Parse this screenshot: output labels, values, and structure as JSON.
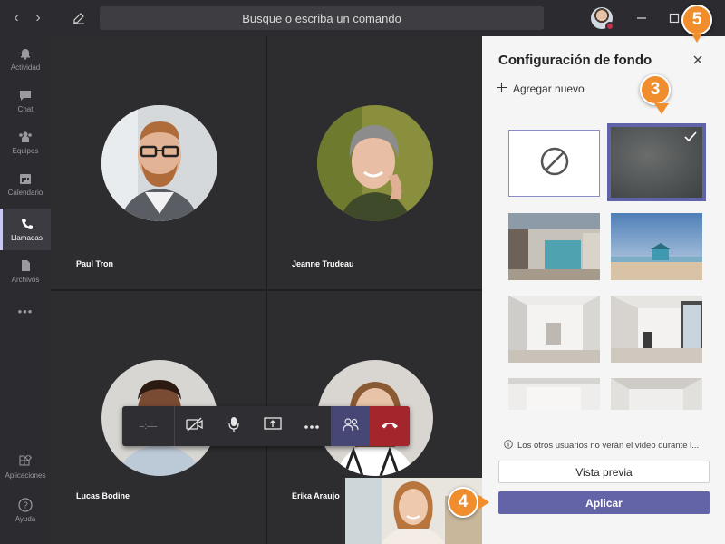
{
  "titlebar": {
    "search_placeholder": "Busque o escriba un comando"
  },
  "rail": {
    "items": [
      {
        "label": "Actividad",
        "icon": "bell-icon"
      },
      {
        "label": "Chat",
        "icon": "chat-icon"
      },
      {
        "label": "Equipos",
        "icon": "teams-icon"
      },
      {
        "label": "Calendario",
        "icon": "calendar-icon"
      },
      {
        "label": "Llamadas",
        "icon": "phone-icon"
      },
      {
        "label": "Archivos",
        "icon": "file-icon"
      }
    ],
    "more": "•••",
    "apps_label": "Aplicaciones",
    "help_label": "Ayuda"
  },
  "participants": [
    {
      "name": "Paul Tron"
    },
    {
      "name": "Jeanne Trudeau"
    },
    {
      "name": "Lucas Bodine"
    },
    {
      "name": "Erika Araujo"
    }
  ],
  "controls": {
    "timer": "–:––"
  },
  "panel": {
    "title": "Configuración de fondo",
    "add_new": "Agregar nuevo",
    "note": "Los otros usuarios no verán el video durante l...",
    "preview_label": "Vista previa",
    "apply_label": "Aplicar"
  },
  "callouts": [
    "3",
    "4",
    "5"
  ],
  "colors": {
    "accent": "#6264a7",
    "callout": "#f08e2e",
    "end_call": "#a4262c"
  }
}
